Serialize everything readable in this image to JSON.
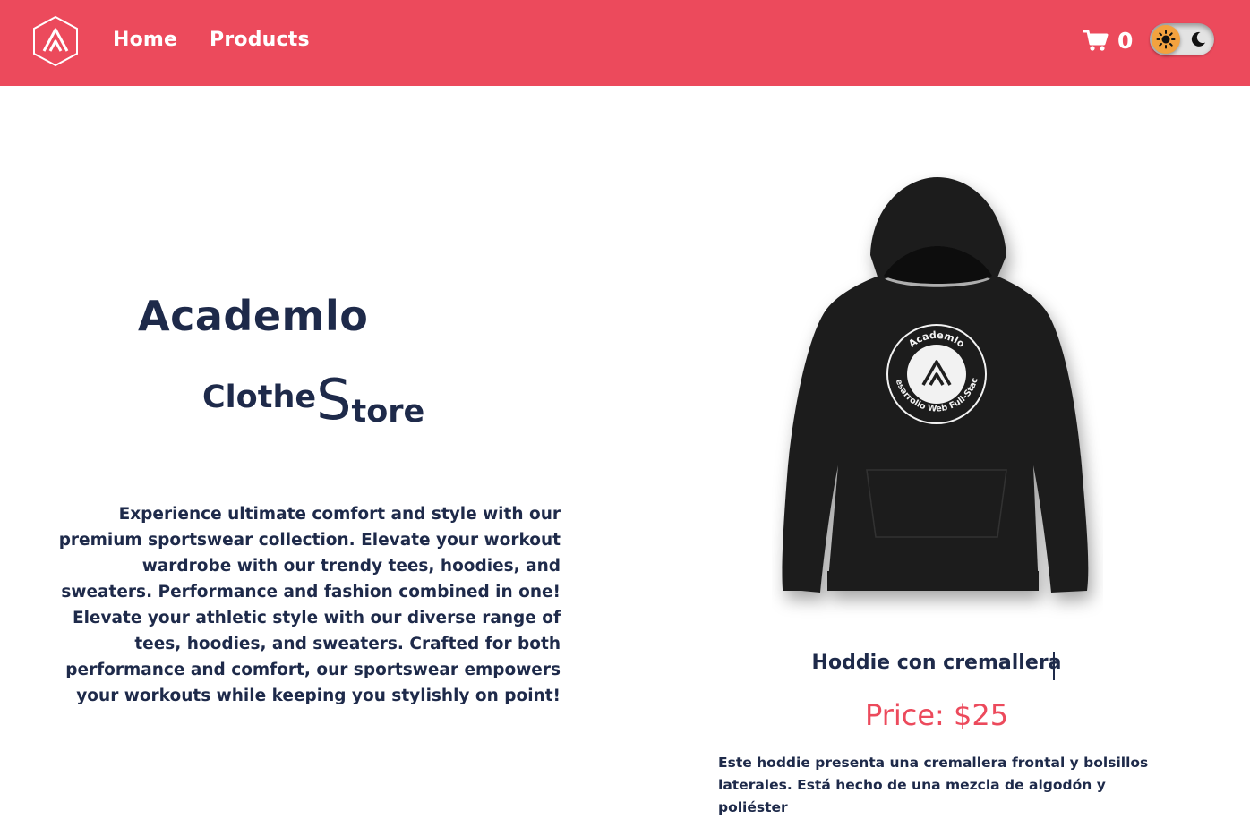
{
  "header": {
    "brand_color": "#ec4a5c",
    "logo_icon": "academlo-logo",
    "nav": [
      {
        "label": "Home"
      },
      {
        "label": "Products"
      }
    ],
    "cart": {
      "icon": "cart-icon",
      "count": "0"
    },
    "theme_toggle": {
      "light_icon": "sun-icon",
      "dark_icon": "moon-icon",
      "active": "light",
      "knob_color": "#f3a23f"
    }
  },
  "hero": {
    "title": "Academlo",
    "subtitle_a": "Clothe",
    "subtitle_b": "S",
    "subtitle_c": "tore",
    "text_color": "#1e2a4a",
    "intro": "Experience ultimate comfort and style with our premium sportswear collection. Elevate your workout wardrobe with our trendy tees, hoodies, and sweaters. Performance and fashion combined in one! Elevate your athletic style with our diverse range of tees, hoodies, and sweaters. Crafted for both performance and comfort, our sportswear empowers your workouts while keeping you stylishly on point!"
  },
  "featured_product": {
    "image_icon": "black-hoodie-image",
    "print_top": "Academlo",
    "print_bottom": "Desarrollo Web Full-Stack",
    "name": "Hoddie con cremallera",
    "price": "Price: $25",
    "price_color": "#ec4a5c",
    "description": "Este hoddie presenta una cremallera frontal y bolsillos laterales. Está hecho de una mezcla de algodón y poliéster"
  }
}
